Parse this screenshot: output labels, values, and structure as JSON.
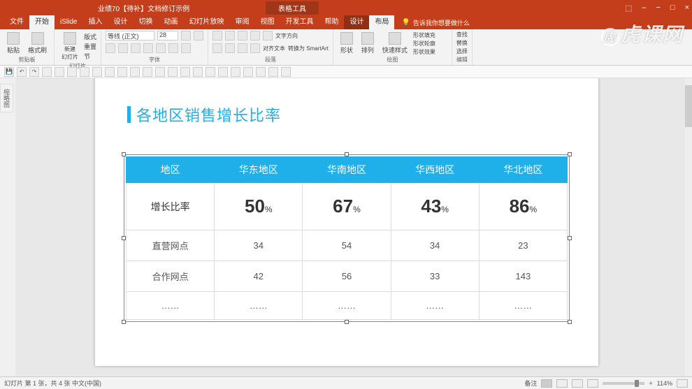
{
  "titlebar": {
    "doc_title": "业绩70【待补】文档修订示例",
    "tab_tools": "表格工具",
    "win": {
      "min": "−",
      "max": "□",
      "close": "×",
      "opt1": "⬚",
      "opt2": "–"
    }
  },
  "ribbon_tabs": {
    "items": [
      "文件",
      "开始",
      "iSlide",
      "插入",
      "设计",
      "切换",
      "动画",
      "幻灯片放映",
      "审阅",
      "视图",
      "开发工具",
      "帮助"
    ],
    "context": [
      "设计",
      "布局"
    ],
    "search_placeholder": "告诉我你想要做什么"
  },
  "ribbon": {
    "clipboard": {
      "paste": "粘贴",
      "fmt": "格式刷",
      "label": "剪贴板"
    },
    "slides": {
      "new": "新建\n幻灯片",
      "layout": "版式",
      "reset": "重置",
      "section": "节",
      "label": "幻灯片"
    },
    "font": {
      "name": "等线 (正文)",
      "size": "28",
      "label": "字体"
    },
    "para": {
      "label": "段落",
      "dir": "文字方向",
      "align": "对齐文本",
      "smart": "转换为 SmartArt"
    },
    "draw": {
      "shapes": "形状",
      "arrange": "排列",
      "quick": "快速样式",
      "fill": "形状填充",
      "outline": "形状轮廓",
      "effects": "形状效果",
      "label": "绘图"
    },
    "edit": {
      "find": "查找",
      "replace": "替换",
      "select": "选择",
      "label": "编辑"
    }
  },
  "side_tab": "缩略图",
  "slide": {
    "title": "各地区销售增长比率"
  },
  "chart_data": {
    "type": "table",
    "headers": [
      "地区",
      "华东地区",
      "华南地区",
      "华西地区",
      "华北地区"
    ],
    "rows": [
      {
        "label": "增长比率",
        "values": [
          "50",
          "67",
          "43",
          "86"
        ],
        "pct": true,
        "highlight": true
      },
      {
        "label": "直营网点",
        "values": [
          "34",
          "54",
          "34",
          "23"
        ]
      },
      {
        "label": "合作网点",
        "values": [
          "42",
          "56",
          "33",
          "143"
        ]
      },
      {
        "label": "……",
        "values": [
          "……",
          "……",
          "……",
          "……"
        ]
      }
    ]
  },
  "status": {
    "left": "幻灯片 第 1 张，共 4 张    中文(中国)",
    "notes": "备注",
    "zoom": "114%",
    "plus": "+"
  },
  "watermark": "虎课网"
}
